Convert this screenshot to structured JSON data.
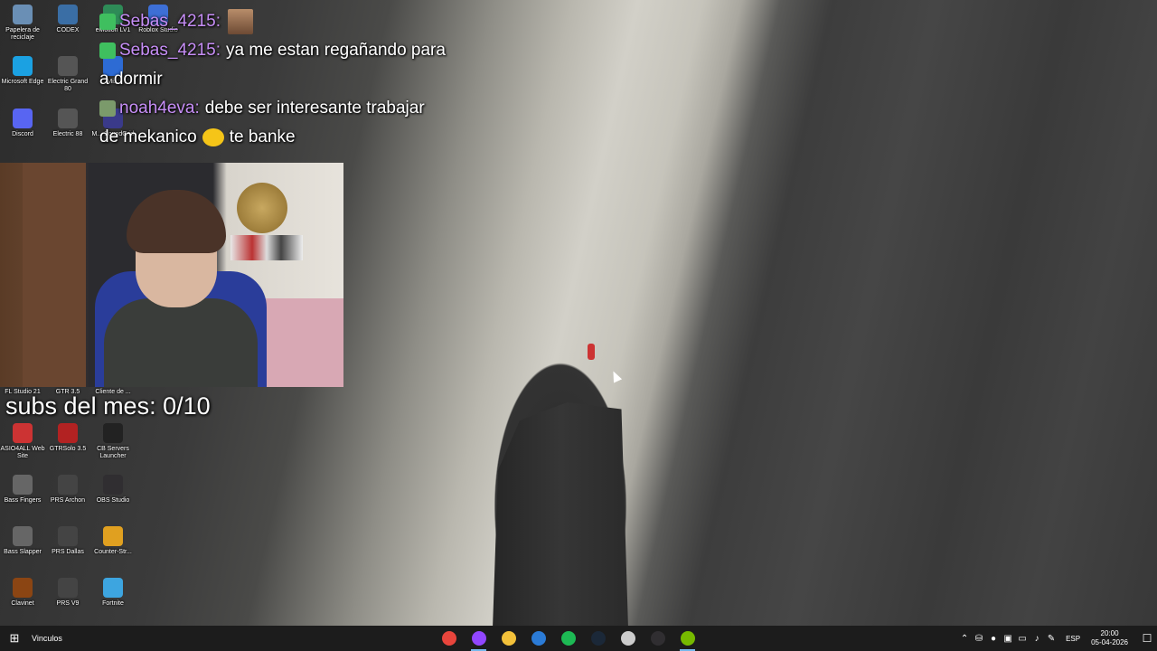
{
  "chat": {
    "messages": [
      {
        "user": "Sebas_4215",
        "sep": ":",
        "text": "",
        "user_color": "#c78ef7"
      },
      {
        "user": "Sebas_4215",
        "sep": ":",
        "text": "ya me estan regañando para",
        "user_color": "#c78ef7"
      },
      {
        "continuation": "a dormir"
      },
      {
        "user": "noah4eva",
        "sep": ":",
        "text": "debe ser interesante trabajar",
        "user_color": "#c78ef7"
      },
      {
        "continuation_a": "de mekanico",
        "continuation_b": "te banke"
      }
    ]
  },
  "subs_counter": "subs del mes: 0/10",
  "desktop_icons": [
    {
      "label": "Papelera de reciclaje",
      "icon": "recycle-bin-icon",
      "color": "#6a8fb5"
    },
    {
      "label": "CODEX",
      "icon": "codex-icon",
      "color": "#3a6ea5"
    },
    {
      "label": "eMotion LV1",
      "icon": "emotion-icon",
      "color": "#2e8b57"
    },
    {
      "label": "Roblox Studio",
      "icon": "roblox-studio-icon",
      "color": "#3d6fd6"
    },
    {
      "label": "Microsoft Edge",
      "icon": "edge-icon",
      "color": "#1ba1e2"
    },
    {
      "label": "Electric Grand 80",
      "icon": "electric-grand-icon",
      "color": "#555555"
    },
    {
      "label": "Mi...",
      "icon": "mixer-icon",
      "color": "#2d6bd4"
    },
    {
      "label": "Discord",
      "icon": "discord-icon",
      "color": "#5865f2"
    },
    {
      "label": "Electric 88",
      "icon": "electric-88-icon",
      "color": "#555555"
    },
    {
      "label": "M... SoundGrid",
      "icon": "soundgrid-icon",
      "color": "#3a3a8a"
    },
    {
      "label": "FL Studio 21",
      "icon": "fl-studio-icon",
      "color": "#ff8c00"
    },
    {
      "label": "GTR 3.5",
      "icon": "gtr-icon",
      "color": "#888888"
    },
    {
      "label": "Cliente de ...",
      "icon": "client-icon",
      "color": "#888888"
    },
    {
      "label": "ASIO4ALL Web Site",
      "icon": "asio4all-icon",
      "color": "#c33"
    },
    {
      "label": "GTRSolo 3.5",
      "icon": "gtrsolo-icon",
      "color": "#b22222"
    },
    {
      "label": "CB Servers Launcher",
      "icon": "cb-launcher-icon",
      "color": "#222222"
    },
    {
      "label": "Bass Fingers",
      "icon": "bass-fingers-icon",
      "color": "#666666"
    },
    {
      "label": "PRS Archon",
      "icon": "prs-archon-icon",
      "color": "#444444"
    },
    {
      "label": "OBS Studio",
      "icon": "obs-icon",
      "color": "#302e31"
    },
    {
      "label": "Bass Slapper",
      "icon": "bass-slapper-icon",
      "color": "#666666"
    },
    {
      "label": "PRS Dallas",
      "icon": "prs-dallas-icon",
      "color": "#444444"
    },
    {
      "label": "Counter-Str...",
      "icon": "counter-strike-icon",
      "color": "#e0a020"
    },
    {
      "label": "Clavinet",
      "icon": "clavinet-icon",
      "color": "#8b4513"
    },
    {
      "label": "PRS V9",
      "icon": "prs-v9-icon",
      "color": "#444444"
    },
    {
      "label": "Fortnite",
      "icon": "fortnite-icon",
      "color": "#3da5e0"
    }
  ],
  "taskbar": {
    "toolbar_label": "Vinculos",
    "apps": [
      {
        "name": "chrome-icon",
        "color": "#e8453c",
        "active": false
      },
      {
        "name": "twitch-app-icon",
        "color": "#9146ff",
        "active": true
      },
      {
        "name": "file-explorer-icon",
        "color": "#f3c13a",
        "active": false
      },
      {
        "name": "store-icon",
        "color": "#2b7bd6",
        "active": false
      },
      {
        "name": "spotify-icon",
        "color": "#1db954",
        "active": false
      },
      {
        "name": "steam-icon",
        "color": "#1b2838",
        "active": false
      },
      {
        "name": "settings-app-icon",
        "color": "#cccccc",
        "active": false
      },
      {
        "name": "obs-taskbar-icon",
        "color": "#302e31",
        "active": false
      },
      {
        "name": "nvidia-icon",
        "color": "#76b900",
        "active": true
      }
    ],
    "language": "ESP",
    "time": "20:00",
    "date": "05-04-2026"
  }
}
